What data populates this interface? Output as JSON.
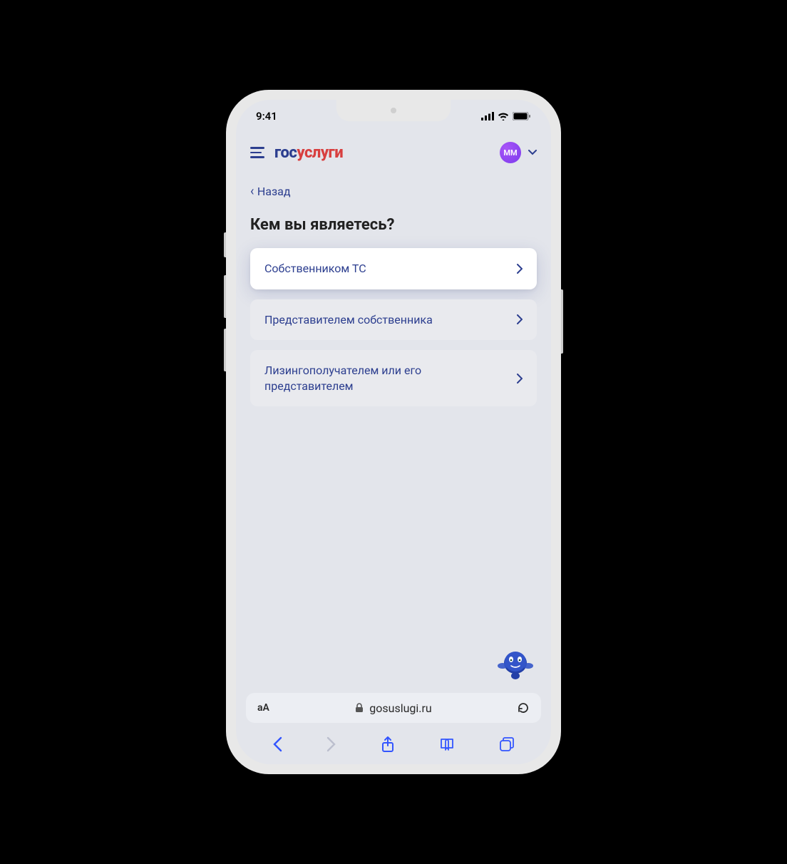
{
  "status": {
    "time": "9:41"
  },
  "header": {
    "logo_part1": "гос",
    "logo_part2": "услуги",
    "avatar_initials": "ММ"
  },
  "nav": {
    "back_label": "Назад"
  },
  "page": {
    "title": "Кем вы являетесь?"
  },
  "options": [
    {
      "label": "Собственником ТС",
      "highlight": true
    },
    {
      "label": "Представителем собственника",
      "highlight": false
    },
    {
      "label": "Лизингополучателем или его представителем",
      "highlight": false
    }
  ],
  "browser": {
    "domain": "gosuslugi.ru",
    "aa": "aA"
  }
}
